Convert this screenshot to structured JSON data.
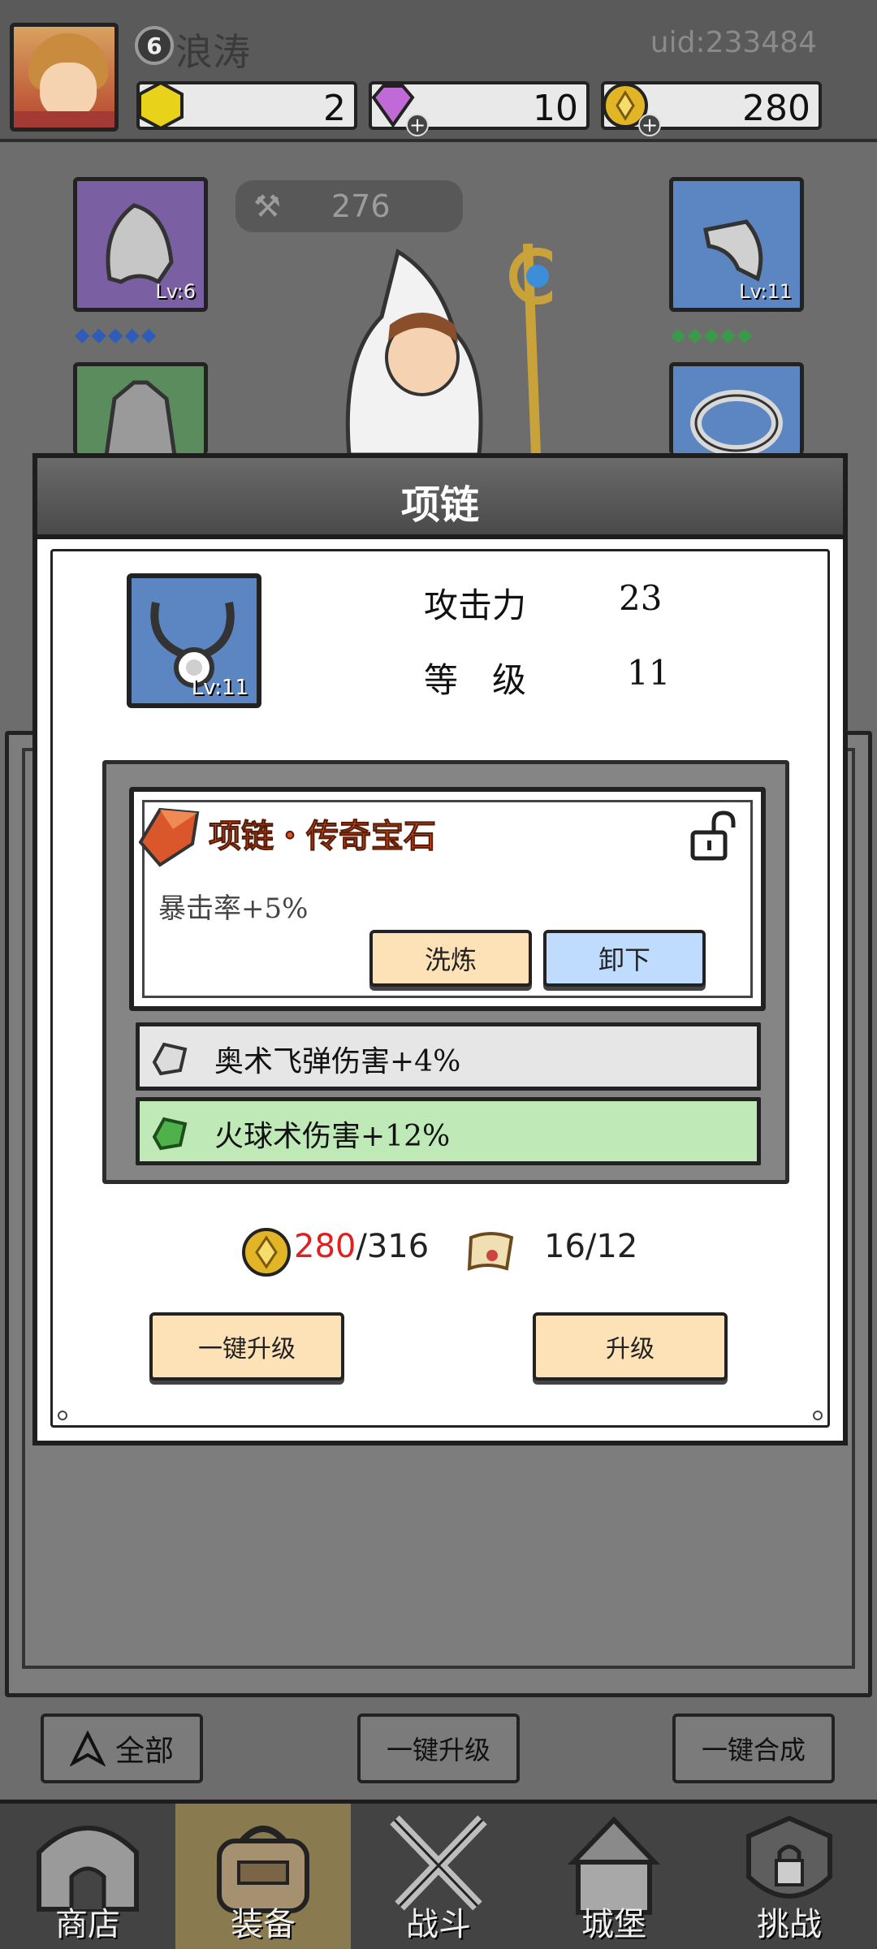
{
  "player": {
    "level": "6",
    "name": "浪涛",
    "uid": "uid:233484"
  },
  "currencies": [
    {
      "name": "gold-hex",
      "value": "2"
    },
    {
      "name": "diamond",
      "value": "10"
    },
    {
      "name": "coin",
      "value": "280"
    }
  ],
  "power": {
    "value": "276"
  },
  "slots": {
    "hood_level": "Lv:6",
    "boots_level": "Lv:11",
    "left_gems": "◆◆◆◆◆",
    "right_gems": "◆◆◆◆◆"
  },
  "dialog": {
    "title": "项链",
    "item_level": "Lv:11",
    "stats": [
      {
        "label": "攻击力",
        "value": "23"
      },
      {
        "label": "等　级",
        "value": "11"
      }
    ],
    "legend_gem": {
      "title": "项链・传奇宝石",
      "effect": "暴击率+5%",
      "refine_label": "洗炼",
      "remove_label": "卸下"
    },
    "sub_gems": [
      {
        "text": "奥术飞弹伤害+4%",
        "color": "#e4e4e4"
      },
      {
        "text": "火球术伤害+12%",
        "color": "#bfeab7"
      }
    ],
    "cost": {
      "coin_current": "280",
      "coin_required": "/316",
      "scroll": "16/12"
    },
    "auto_upgrade_label": "一键升级",
    "upgrade_label": "升级"
  },
  "actions": {
    "filter_label": "全部",
    "upgrade_all_label": "一键升级",
    "merge_all_label": "一键合成"
  },
  "tabs": [
    {
      "label": "商店",
      "icon": "shop-icon"
    },
    {
      "label": "装备",
      "icon": "equipment-icon"
    },
    {
      "label": "战斗",
      "icon": "battle-icon"
    },
    {
      "label": "城堡",
      "icon": "castle-icon"
    },
    {
      "label": "挑战",
      "icon": "challenge-icon"
    }
  ],
  "colors": {
    "accent_red": "#e02020",
    "legend_title": "#e0581f",
    "modal_header": "#5a5a5a",
    "active_tab": "#8a7a4f"
  }
}
